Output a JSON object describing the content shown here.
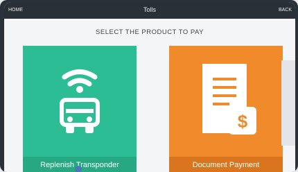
{
  "topbar": {
    "home_label": "HOME",
    "title": "Tolls",
    "back_label": "BACK"
  },
  "prompt": "SELECT THE PRODUCT TO PAY",
  "products": [
    {
      "label": "Replenish Transponder",
      "icon": "car-transponder-icon",
      "color": "#2dbd94"
    },
    {
      "label": "Document Payment",
      "icon": "document-dollar-icon",
      "color": "#f08a2a"
    }
  ]
}
